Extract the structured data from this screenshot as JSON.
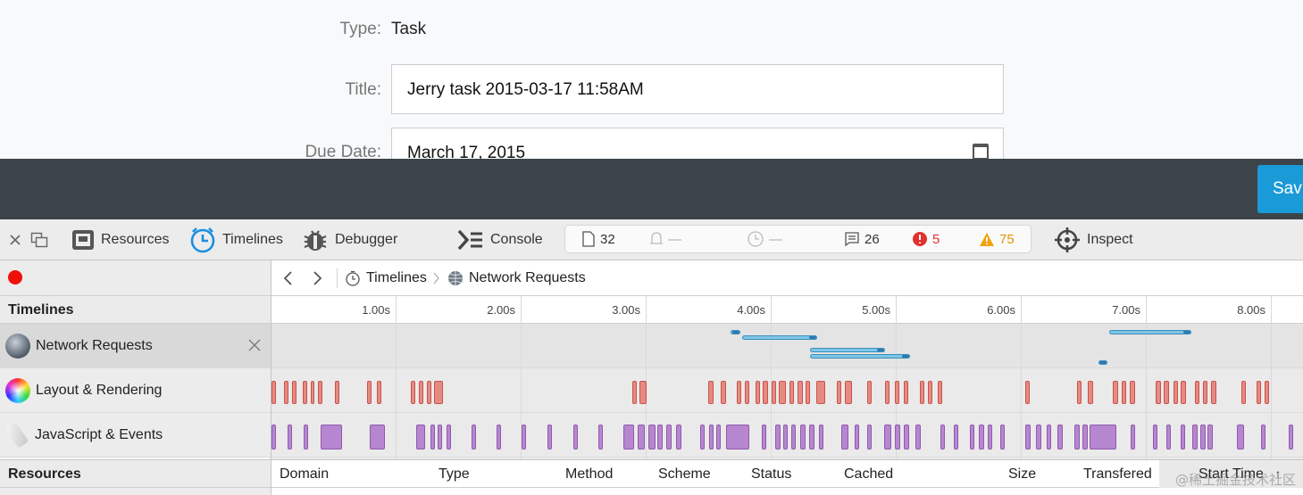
{
  "form": {
    "type_label": "Type:",
    "type_value": "Task",
    "title_label": "Title:",
    "title_value": "Jerry task 2015-03-17 11:58AM",
    "due_label": "Due Date:",
    "due_value": "March 17, 2015"
  },
  "actions": {
    "save_label": "Sav"
  },
  "toolbar": {
    "resources": "Resources",
    "timelines": "Timelines",
    "debugger": "Debugger",
    "console": "Console",
    "inspect": "Inspect",
    "resource_count": "32",
    "bell_value": "—",
    "clock_value": "—",
    "log_count": "26",
    "error_count": "5",
    "warning_count": "75"
  },
  "breadcrumb": {
    "timelines": "Timelines",
    "network": "Network Requests"
  },
  "timelines_header": "Timelines",
  "ticks": [
    "1.00s",
    "2.00s",
    "3.00s",
    "4.00s",
    "5.00s",
    "6.00s",
    "7.00s",
    "8.00s"
  ],
  "tracks": {
    "network": "Network Requests",
    "layout": "Layout & Rendering",
    "js": "JavaScript & Events"
  },
  "resources_header": "Resources",
  "columns": [
    "Domain",
    "Type",
    "Method",
    "Scheme",
    "Status",
    "Cached",
    "Size",
    "Transfered",
    "Start Time"
  ],
  "watermark": "@稀土掘金技术社区",
  "colors": {
    "dark_bar": "#3c4449",
    "save_button": "#1a9ad6",
    "layout_event": "#e68a82",
    "script_event": "#b786d0",
    "network_request": "#7ec6e6",
    "error": "#e0322f",
    "warning": "#f0a30a"
  }
}
